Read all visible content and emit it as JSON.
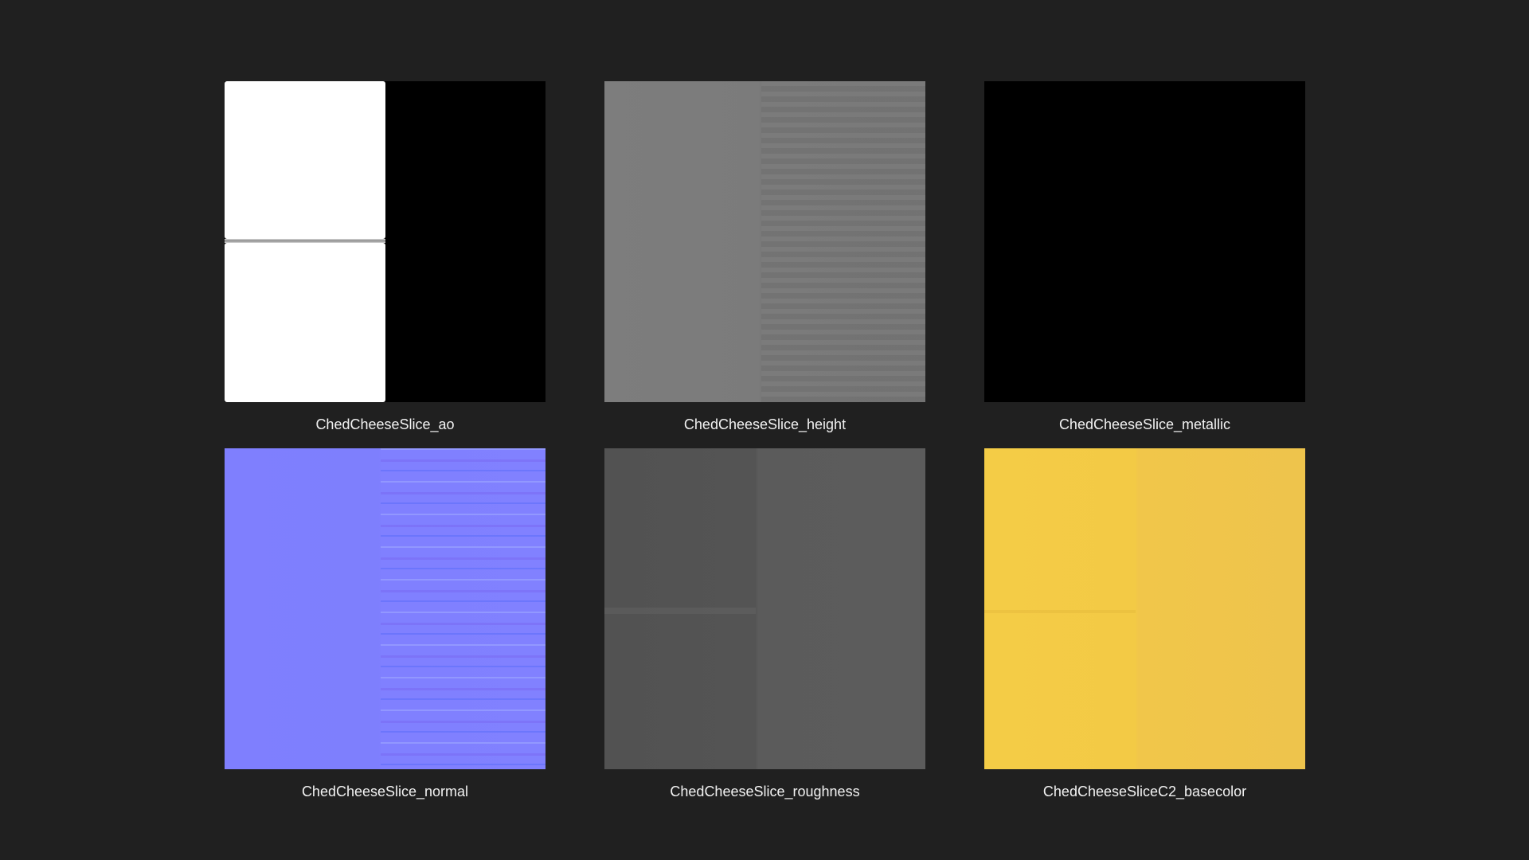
{
  "background_color": "#202020",
  "files": [
    {
      "name": "ChedCheeseSlice_ao",
      "icon": "ao-texture-thumbnail"
    },
    {
      "name": "ChedCheeseSlice_height",
      "icon": "height-texture-thumbnail"
    },
    {
      "name": "ChedCheeseSlice_metallic",
      "icon": "metallic-texture-thumbnail"
    },
    {
      "name": "ChedCheeseSlice_normal",
      "icon": "normal-texture-thumbnail"
    },
    {
      "name": "ChedCheeseSlice_roughness",
      "icon": "roughness-texture-thumbnail"
    },
    {
      "name": "ChedCheeseSliceC2_basecolor",
      "icon": "basecolor-texture-thumbnail"
    }
  ]
}
